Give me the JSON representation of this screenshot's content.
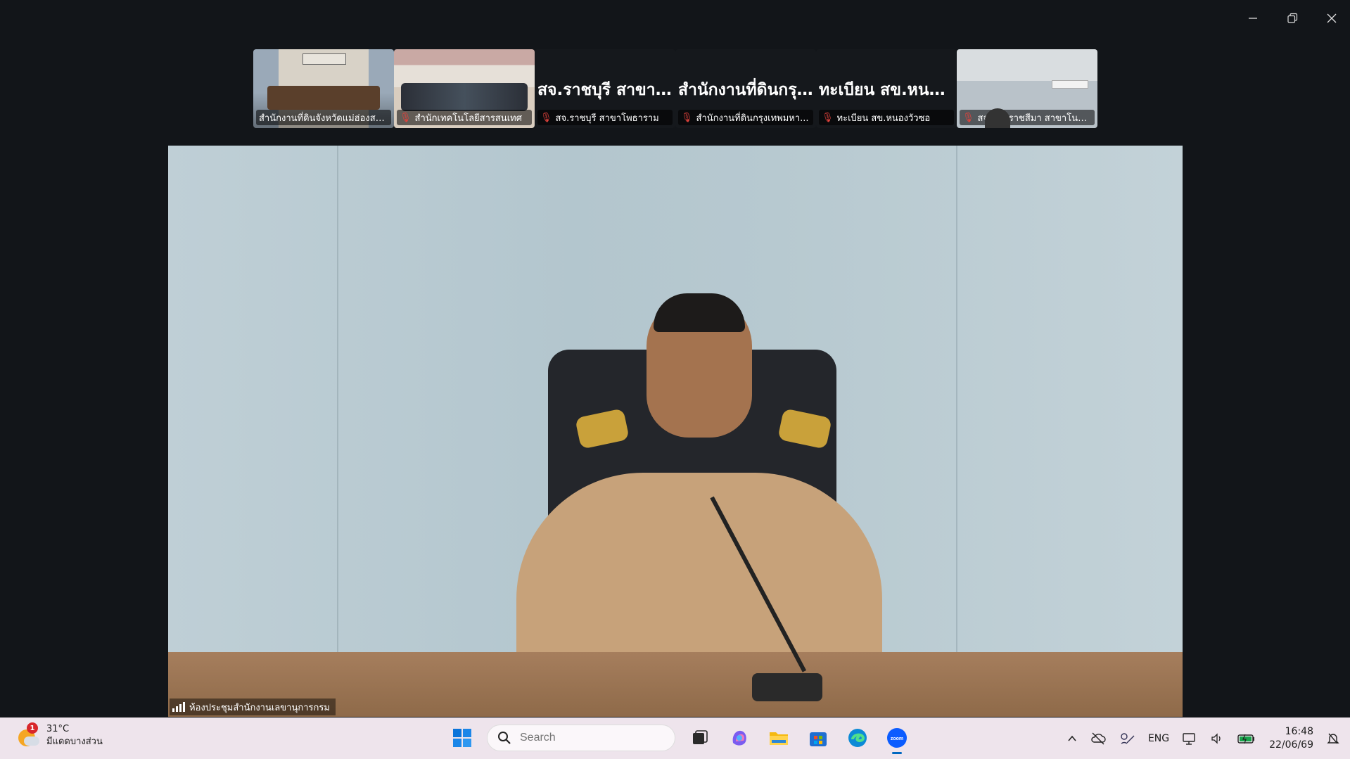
{
  "window": {
    "controls": {
      "minimize": "minimize",
      "restore": "restore",
      "close": "close"
    }
  },
  "gallery": [
    {
      "kind": "photo1",
      "label": "สำนักงานที่ดินจังหวัดแม่ฮ่องสอ...",
      "muted": false
    },
    {
      "kind": "photo2",
      "label": "สำนักเทคโนโลยีสารสนเทศ",
      "muted": true
    },
    {
      "kind": "blank",
      "name": "สจ.ราชบุรี สาขาโ...",
      "label": "สจ.ราชบุรี สาขาโพธาราม",
      "muted": true
    },
    {
      "kind": "blank",
      "name": "สำนักงานที่ดินกรุ...",
      "label": "สำนักงานที่ดินกรุงเทพมหา...",
      "muted": true
    },
    {
      "kind": "blank",
      "name": "ทะเบียน สข.หนอ...",
      "label": "ทะเบียน สข.หนองวัวซอ",
      "muted": true
    },
    {
      "kind": "photo3",
      "label": "สจ.นครราชสีมา สาขาโนน...",
      "muted": true
    }
  ],
  "speaker": {
    "label": "ห้องประชุมสำนักงานเลขานุการกรม"
  },
  "taskbar": {
    "weather": {
      "temp": "31°C",
      "desc": "มีแดดบางส่วน",
      "badge": "1"
    },
    "search": {
      "placeholder": "Search"
    },
    "icons": [
      "windows-start-icon",
      "search-icon",
      "task-view-icon",
      "copilot-icon",
      "file-explorer-icon",
      "microsoft-store-icon",
      "edge-icon",
      "zoom-icon"
    ],
    "tray": {
      "language": "ENG",
      "time": "16:48",
      "date": "22/06/69"
    }
  },
  "colors": {
    "background": "#121519",
    "taskbar": "#eee4ec",
    "muted_icon": "#e0423c",
    "zoom_blue": "#0b5cff"
  }
}
